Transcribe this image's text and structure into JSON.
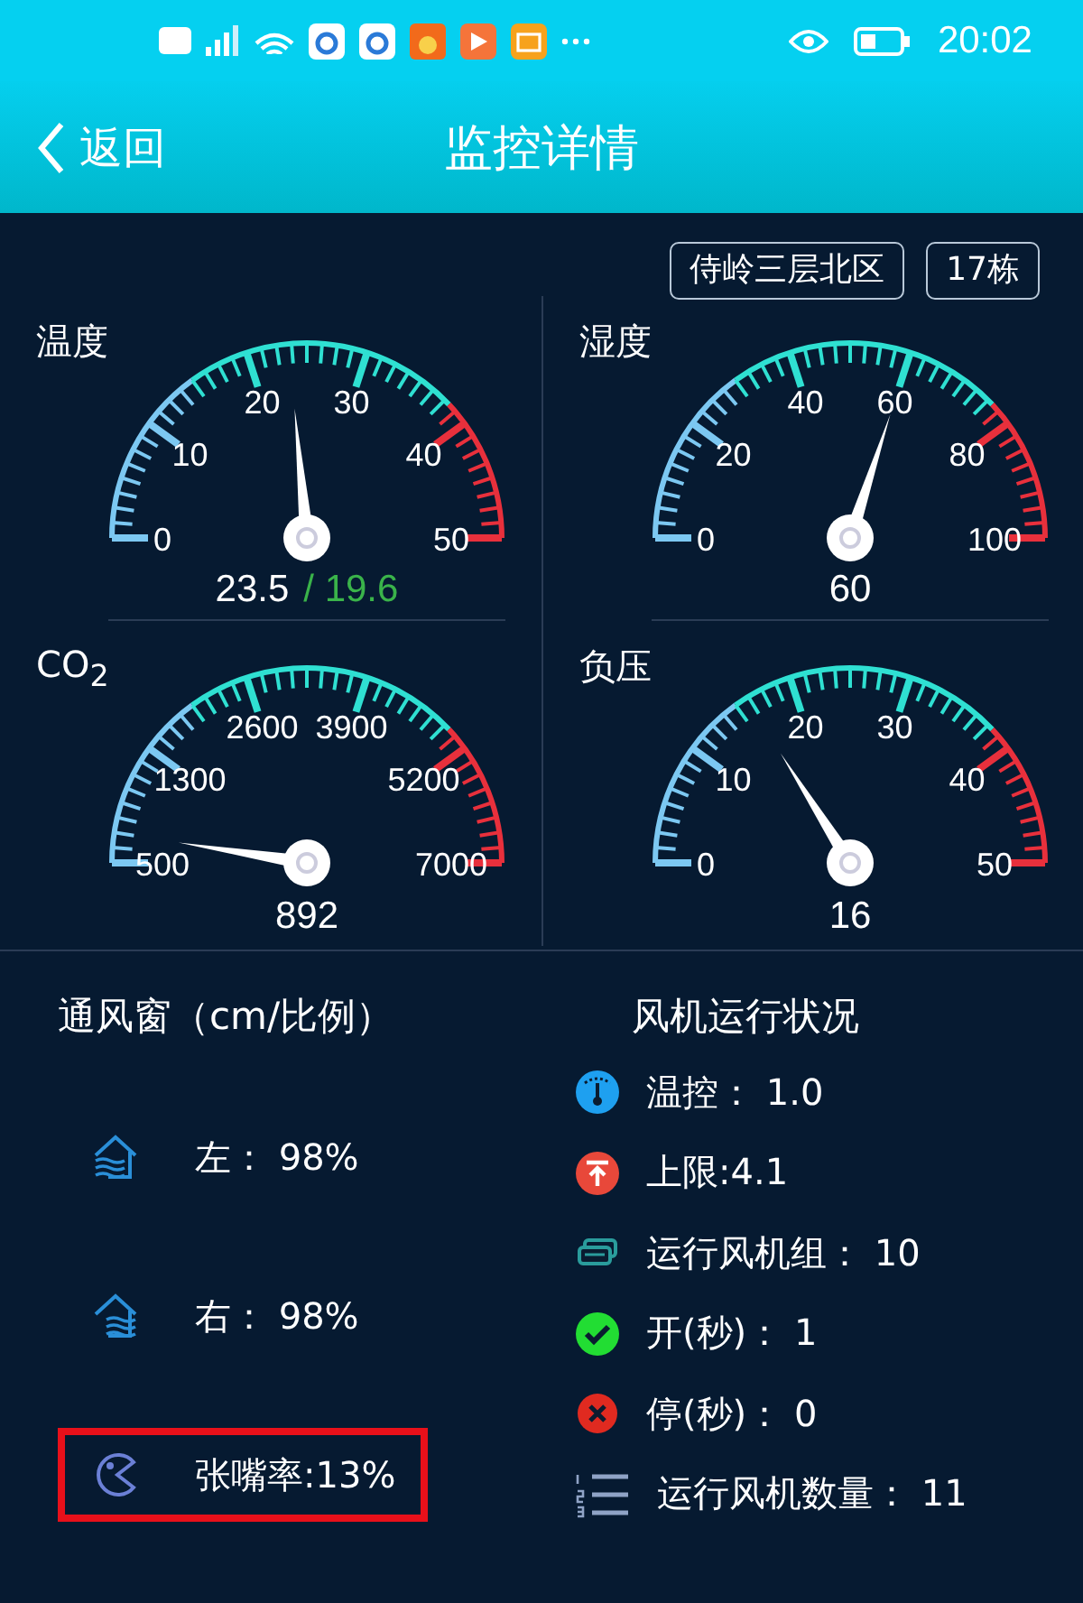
{
  "status_bar": {
    "time": "20:02"
  },
  "header": {
    "back": "返回",
    "title": "监控详情"
  },
  "tags": [
    "侍岭三层北区",
    "17栋"
  ],
  "gauges": [
    {
      "title": "温度",
      "ticks": [
        "0",
        "10",
        "20",
        "30",
        "40",
        "50"
      ],
      "value": "23.5",
      "secondary": "/ 19.6"
    },
    {
      "title": "湿度",
      "ticks": [
        "0",
        "20",
        "40",
        "60",
        "80",
        "100"
      ],
      "value": "60"
    },
    {
      "title": "CO$_{2}$",
      "ticks": [
        "500",
        "1300",
        "2600",
        "3900",
        "5200",
        "7000"
      ],
      "value": "892"
    },
    {
      "title": "负压",
      "ticks": [
        "0",
        "10",
        "20",
        "30",
        "40",
        "50"
      ],
      "value": "16"
    }
  ],
  "vents": {
    "title": "通风窗（cm/比例）",
    "items": [
      {
        "kind": "left",
        "text": "左：  98%",
        "highlighted": false
      },
      {
        "kind": "right",
        "text": "右：  98%",
        "highlighted": false
      },
      {
        "kind": "opening",
        "text": "张嘴率:13%",
        "highlighted": true
      }
    ]
  },
  "fans": {
    "title": "风机运行状况",
    "items": [
      {
        "kind": "thermo",
        "text": "温控：  1.0"
      },
      {
        "kind": "limit",
        "text": "上限:4.1"
      },
      {
        "kind": "group",
        "text": "运行风机组：  10"
      },
      {
        "kind": "on",
        "text": "开(秒)：  1"
      },
      {
        "kind": "off",
        "text": "停(秒)：  0"
      },
      {
        "kind": "count",
        "text": "运行风机数量：  11"
      }
    ]
  }
}
